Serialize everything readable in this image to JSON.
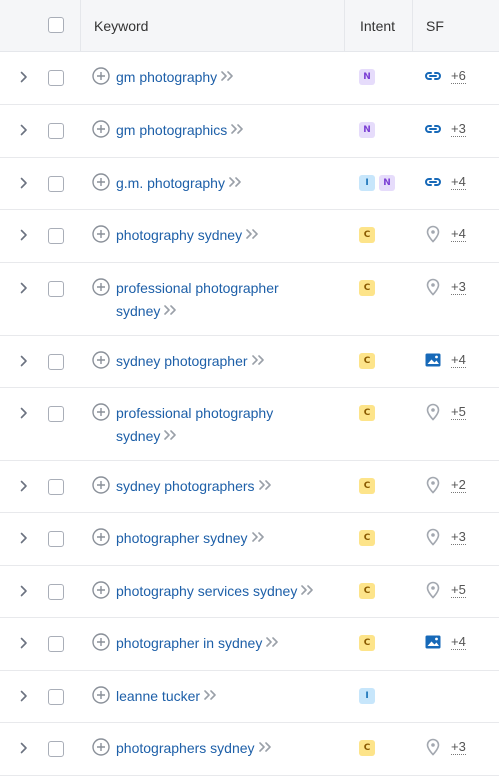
{
  "header": {
    "keyword": "Keyword",
    "intent": "Intent",
    "sf": "SF"
  },
  "rows": [
    {
      "keyword": "gm photography",
      "line2": "",
      "intents": [
        "N"
      ],
      "sf_icon": "link-icon",
      "sf_count": "+6"
    },
    {
      "keyword": "gm photographics",
      "line2": "",
      "intents": [
        "N"
      ],
      "sf_icon": "link-icon",
      "sf_count": "+3"
    },
    {
      "keyword": "g.m. photography",
      "line2": "",
      "intents": [
        "I",
        "N"
      ],
      "sf_icon": "link-icon",
      "sf_count": "+4"
    },
    {
      "keyword": "photography sydney",
      "line2": "",
      "intents": [
        "C"
      ],
      "sf_icon": "location-pin-icon",
      "sf_count": "+4"
    },
    {
      "keyword": "professional photographer",
      "line2": "sydney",
      "intents": [
        "C"
      ],
      "sf_icon": "location-pin-icon",
      "sf_count": "+3"
    },
    {
      "keyword": "sydney photographer",
      "line2": "",
      "intents": [
        "C"
      ],
      "sf_icon": "image-icon",
      "sf_count": "+4"
    },
    {
      "keyword": "professional photography",
      "line2": "sydney",
      "intents": [
        "C"
      ],
      "sf_icon": "location-pin-icon",
      "sf_count": "+5"
    },
    {
      "keyword": "sydney photographers",
      "line2": "",
      "intents": [
        "C"
      ],
      "sf_icon": "location-pin-icon",
      "sf_count": "+2"
    },
    {
      "keyword": "photographer sydney",
      "line2": "",
      "intents": [
        "C"
      ],
      "sf_icon": "location-pin-icon",
      "sf_count": "+3"
    },
    {
      "keyword": "photography services sydney",
      "line2": "",
      "intents": [
        "C"
      ],
      "sf_icon": "location-pin-icon",
      "sf_count": "+5"
    },
    {
      "keyword": "photographer in sydney",
      "line2": "",
      "intents": [
        "C"
      ],
      "sf_icon": "image-icon",
      "sf_count": "+4"
    },
    {
      "keyword": "leanne tucker",
      "line2": "",
      "intents": [
        "I"
      ],
      "sf_icon": "",
      "sf_count": ""
    },
    {
      "keyword": "photographers sydney",
      "line2": "",
      "intents": [
        "C"
      ],
      "sf_icon": "location-pin-icon",
      "sf_count": "+3"
    }
  ],
  "colors": {
    "link": "#1d5fa8",
    "intent_N": "#e6dcfb",
    "intent_I": "#c7e6fb",
    "intent_C": "#fde48a"
  }
}
